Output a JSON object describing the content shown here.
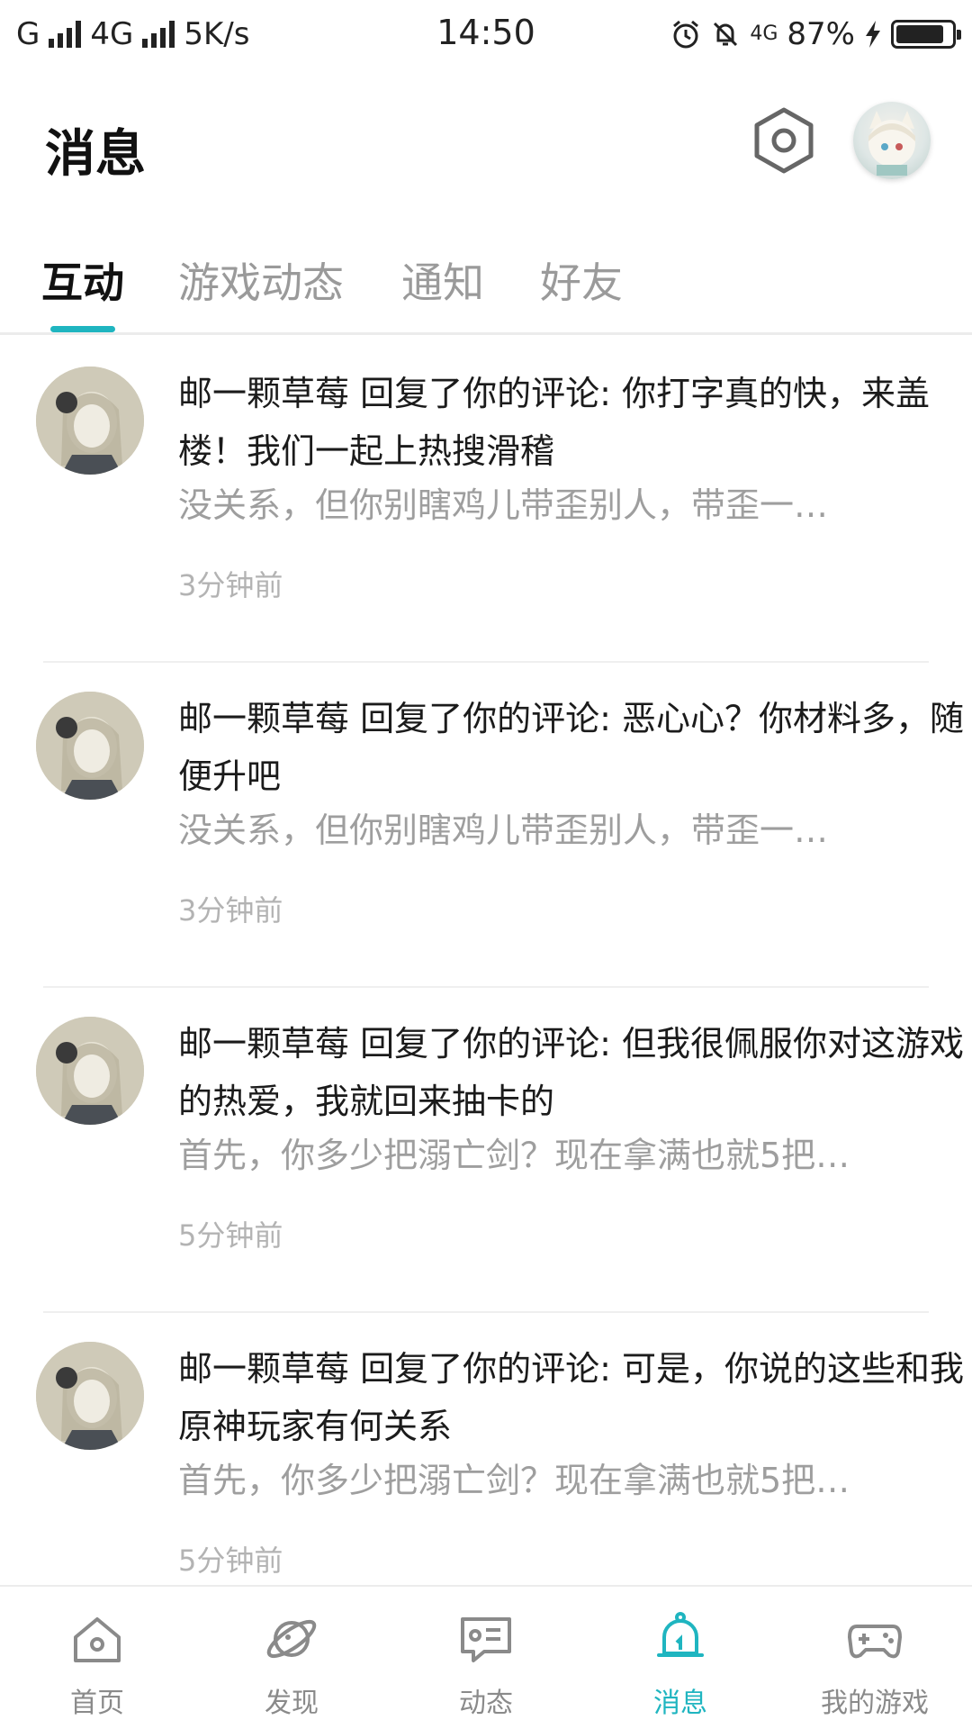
{
  "status_bar": {
    "carrier1": "G",
    "carrier2": "4G",
    "speed": "5K/s",
    "time": "14:50",
    "network_badge": "4G",
    "battery": "87%",
    "battery_level": 0.87
  },
  "header": {
    "title": "消息"
  },
  "tabs": [
    {
      "label": "互动",
      "active": true
    },
    {
      "label": "游戏动态",
      "active": false
    },
    {
      "label": "通知",
      "active": false
    },
    {
      "label": "好友",
      "active": false
    }
  ],
  "messages": [
    {
      "title": "邮一颗草莓 回复了你的评论: 你打字真的快，来盖楼！我们一起上热搜滑稽",
      "preview": "没关系，但你别瞎鸡儿带歪别人，带歪一…",
      "time": "3分钟前"
    },
    {
      "title": "邮一颗草莓 回复了你的评论: 恶心心？你材料多，随便升吧",
      "preview": "没关系，但你别瞎鸡儿带歪别人，带歪一…",
      "time": "3分钟前"
    },
    {
      "title": "邮一颗草莓 回复了你的评论: 但我很佩服你对这游戏的热爱，我就回来抽卡的",
      "preview": "首先，你多少把溺亡剑？现在拿满也就5把…",
      "time": "5分钟前"
    },
    {
      "title": "邮一颗草莓 回复了你的评论: 可是，你说的这些和我原神玩家有何关系",
      "preview": "首先，你多少把溺亡剑？现在拿满也就5把…",
      "time": "5分钟前"
    }
  ],
  "bottom_nav": [
    {
      "label": "首页",
      "icon": "home-icon",
      "active": false
    },
    {
      "label": "发现",
      "icon": "planet-icon",
      "active": false
    },
    {
      "label": "动态",
      "icon": "feed-icon",
      "active": false
    },
    {
      "label": "消息",
      "icon": "bell-icon",
      "active": true
    },
    {
      "label": "我的游戏",
      "icon": "gamepad-icon",
      "active": false
    }
  ],
  "colors": {
    "accent": "#1fb5c0",
    "text": "#1b1b1b",
    "muted": "#9e9e9e"
  }
}
